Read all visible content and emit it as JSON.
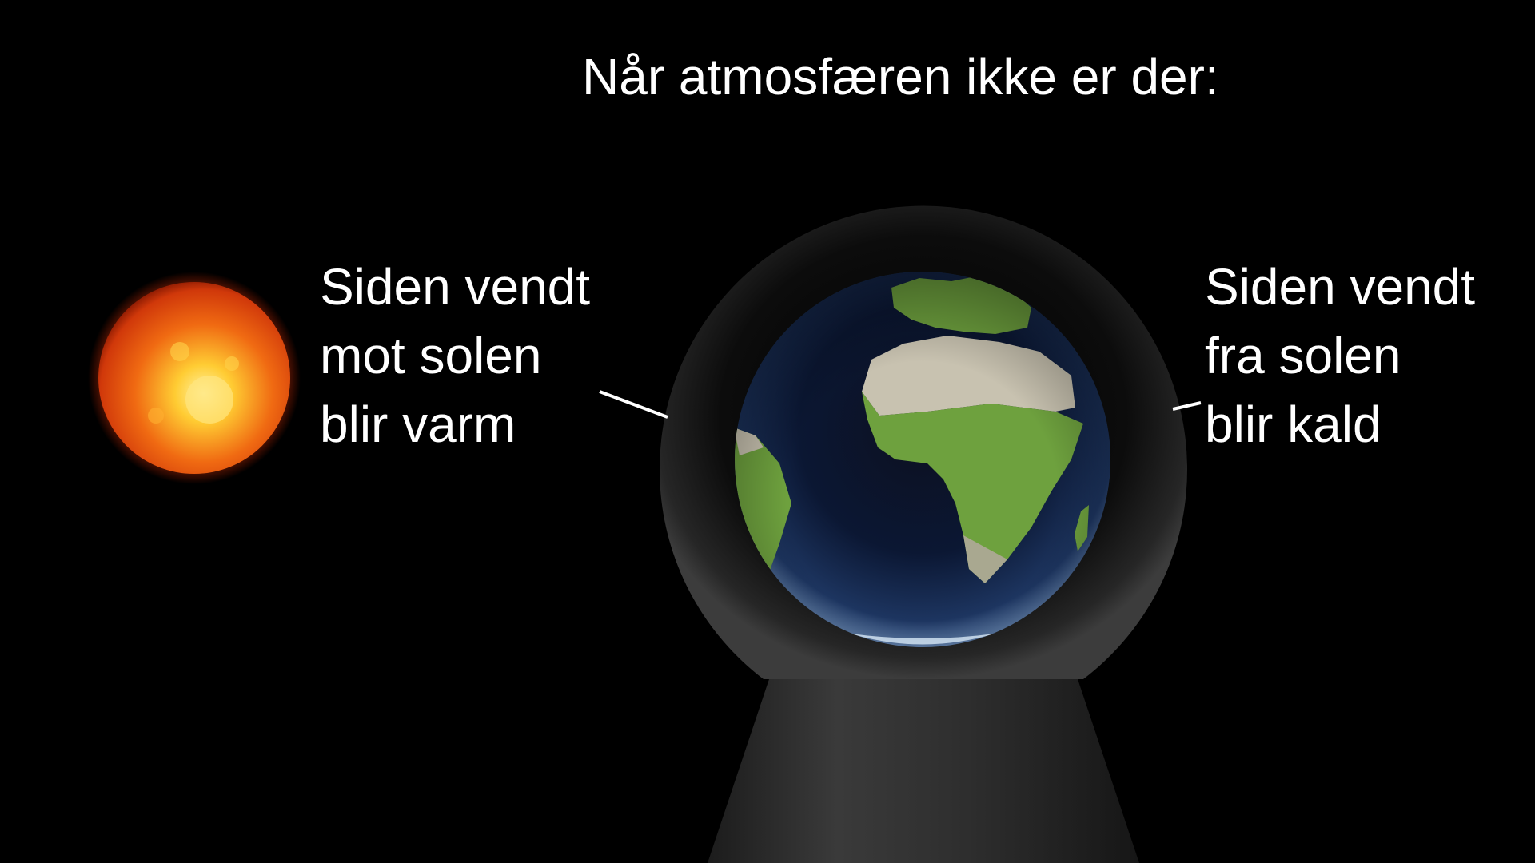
{
  "slide": {
    "title": "Når atmosfæren ikke er der:",
    "left_label": {
      "lines": [
        "Siden vendt",
        "mot solen",
        "blir varm"
      ]
    },
    "right_label": {
      "lines": [
        "Siden vendt",
        "fra solen",
        "blir kald"
      ]
    }
  },
  "colors": {
    "background": "#000000",
    "text": "#ffffff",
    "sun_core": "#ffcc33",
    "sun_edge": "#c72a05",
    "ocean": "#0a1630",
    "land": "#6ea13e",
    "desert": "#c8c2b0",
    "dome": "#1a1a1a",
    "pedestal": "#2b2b2b"
  },
  "icons": {
    "sun": "sun-icon",
    "earth": "earth-globe-icon"
  }
}
